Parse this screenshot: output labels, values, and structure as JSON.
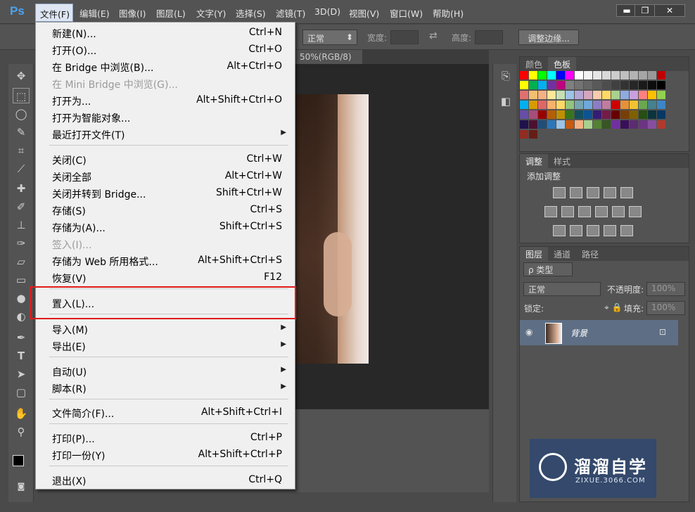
{
  "app": {
    "logo": "Ps"
  },
  "menubar": {
    "items": [
      "文件(F)",
      "编辑(E)",
      "图像(I)",
      "图层(L)",
      "文字(Y)",
      "选择(S)",
      "滤镜(T)",
      "3D(D)",
      "视图(V)",
      "窗口(W)",
      "帮助(H)"
    ]
  },
  "window_buttons": {
    "minimize": "▬",
    "restore": "❐",
    "close": "✕"
  },
  "options_bar": {
    "mode_value": "正常",
    "width_label": "宽度:",
    "height_label": "高度:",
    "refine_edge": "调整边缘..."
  },
  "document": {
    "tab_label": "50%(RGB/8)",
    "tab_close": "×"
  },
  "file_menu": {
    "items": [
      {
        "label": "新建(N)...",
        "shortcut": "Ctrl+N"
      },
      {
        "label": "打开(O)...",
        "shortcut": "Ctrl+O"
      },
      {
        "label": "在 Bridge 中浏览(B)...",
        "shortcut": "Alt+Ctrl+O"
      },
      {
        "label": "在 Mini Bridge 中浏览(G)...",
        "shortcut": ""
      },
      {
        "label": "打开为...",
        "shortcut": "Alt+Shift+Ctrl+O"
      },
      {
        "label": "打开为智能对象...",
        "shortcut": ""
      },
      {
        "label": "最近打开文件(T)",
        "shortcut": ""
      },
      {
        "label": "关闭(C)",
        "shortcut": "Ctrl+W"
      },
      {
        "label": "关闭全部",
        "shortcut": "Alt+Ctrl+W"
      },
      {
        "label": "关闭并转到 Bridge...",
        "shortcut": "Shift+Ctrl+W"
      },
      {
        "label": "存储(S)",
        "shortcut": "Ctrl+S"
      },
      {
        "label": "存储为(A)...",
        "shortcut": "Shift+Ctrl+S"
      },
      {
        "label": "签入(I)...",
        "shortcut": ""
      },
      {
        "label": "存储为 Web 所用格式...",
        "shortcut": "Alt+Shift+Ctrl+S"
      },
      {
        "label": "恢复(V)",
        "shortcut": "F12"
      },
      {
        "label": "置入(L)...",
        "shortcut": ""
      },
      {
        "label": "导入(M)",
        "shortcut": ""
      },
      {
        "label": "导出(E)",
        "shortcut": ""
      },
      {
        "label": "自动(U)",
        "shortcut": ""
      },
      {
        "label": "脚本(R)",
        "shortcut": ""
      },
      {
        "label": "文件简介(F)...",
        "shortcut": "Alt+Shift+Ctrl+I"
      },
      {
        "label": "打印(P)...",
        "shortcut": "Ctrl+P"
      },
      {
        "label": "打印一份(Y)",
        "shortcut": "Alt+Shift+Ctrl+P"
      },
      {
        "label": "退出(X)",
        "shortcut": "Ctrl+Q"
      }
    ],
    "submenu_arrow": "▶"
  },
  "panels": {
    "swatches_tabs": [
      "颜色",
      "色板"
    ],
    "adjust_tabs": [
      "调整",
      "样式"
    ],
    "adjust_title": "添加调整",
    "layers_tabs": [
      "图层",
      "通道",
      "路径"
    ],
    "layers_filter": "ρ 类型",
    "blend_mode": "正常",
    "opacity_label": "不透明度:",
    "opacity_value": "100%",
    "lock_label": "锁定:",
    "fill_label": "填充:",
    "fill_value": "100%",
    "layer_name": "背景"
  },
  "watermark": {
    "text": "溜溜自学",
    "url": "ZIXUE.3066.COM"
  },
  "swatch_colors": [
    "#ff0000",
    "#ffff00",
    "#00ff00",
    "#00ffff",
    "#0000ff",
    "#ff00ff",
    "#ffffff",
    "#f2f2f2",
    "#e6e6e6",
    "#d9d9d9",
    "#cccccc",
    "#bfbfbf",
    "#b3b3b3",
    "#a6a6a6",
    "#999999",
    "#c00000",
    "#ffff00",
    "#00b050",
    "#00b0f0",
    "#7030a0",
    "#c00080",
    "#808080",
    "#737373",
    "#666666",
    "#595959",
    "#4d4d4d",
    "#404040",
    "#333333",
    "#262626",
    "#1a1a1a",
    "#0d0d0d",
    "#000000",
    "#e07070",
    "#f0c070",
    "#f4b183",
    "#ffe699",
    "#c6e0b4",
    "#9dc3e6",
    "#b4a7d6",
    "#d5a6bd",
    "#f8cbad",
    "#ffd966",
    "#a9d18e",
    "#8faadc",
    "#c9a0dc",
    "#ff8080",
    "#ffc000",
    "#92d050",
    "#00b0f0",
    "#d79b00",
    "#e06666",
    "#f6b26b",
    "#ffd966",
    "#93c47d",
    "#76a5af",
    "#6fa8dc",
    "#8e7cc3",
    "#c27ba0",
    "#cc0000",
    "#e69138",
    "#f1c232",
    "#6aa84f",
    "#45818e",
    "#3d85c6",
    "#674ea7",
    "#a64d79",
    "#990000",
    "#b45f06",
    "#bf9000",
    "#38761d",
    "#134f5c",
    "#0b5394",
    "#351c75",
    "#741b47",
    "#660000",
    "#783f04",
    "#7f6000",
    "#274e13",
    "#0c343d",
    "#073763",
    "#20124d",
    "#4c1130",
    "#1f4e79",
    "#2e75b6",
    "#9cc3e5",
    "#c55a11",
    "#f4b183",
    "#a9d08e",
    "#548235",
    "#375623",
    "#7030a0",
    "#3a0f5a",
    "#5b2c6f",
    "#6c3483",
    "#884ea0",
    "#b03a2e",
    "#922b21",
    "#641e16"
  ]
}
